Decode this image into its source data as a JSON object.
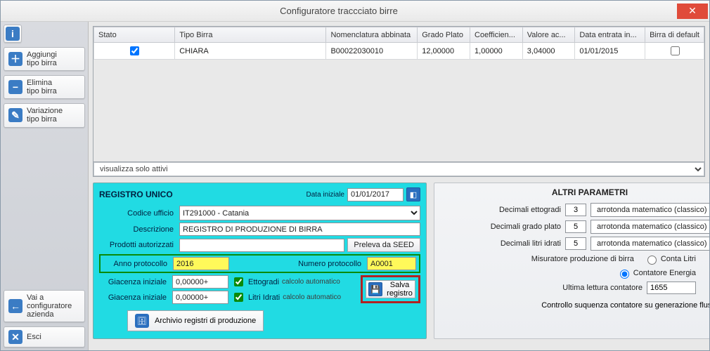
{
  "window": {
    "title": "Configuratore traccciato birre"
  },
  "sidebar": {
    "add": "Aggiungi\ntipo birra",
    "del": "Elimina\ntipo birra",
    "var": "Variazione\ntipo birra",
    "goto": "Vai a\nconfiguratore\nazienda",
    "exit": "Esci"
  },
  "grid": {
    "headers": {
      "stato": "Stato",
      "tipo": "Tipo Birra",
      "nomen": "Nomenclatura abbinata",
      "plato": "Grado Plato",
      "coef": "Coefficien...",
      "val": "Valore ac...",
      "data": "Data entrata in...",
      "def": "Birra di default"
    },
    "row": {
      "stato_checked": true,
      "tipo": "CHIARA",
      "nomen": "B00022030010",
      "plato": "12,00000",
      "coef": "1,00000",
      "val": "3,04000",
      "data": "01/01/2015",
      "def_checked": false
    },
    "filter": "visualizza solo attivi"
  },
  "registro": {
    "title": "REGISTRO UNICO",
    "data_iniziale_lbl": "Data iniziale",
    "data_iniziale": "01/01/2017",
    "codice_ufficio_lbl": "Codice ufficio",
    "codice_ufficio": "IT291000 - Catania",
    "descrizione_lbl": "Descrizione",
    "descrizione": "REGISTRO DI PRODUZIONE DI BIRRA",
    "prodotti_lbl": "Prodotti autorizzati",
    "prodotti": "",
    "seed_btn": "Preleva da SEED",
    "anno_lbl": "Anno protocollo",
    "anno": "2016",
    "num_lbl": "Numero protocollo",
    "num": "A0001",
    "giac1_lbl": "Giacenza iniziale",
    "giac1": "0,00000+",
    "giac2_lbl": "Giacenza iniziale",
    "giac2": "0,00000+",
    "ettogradi_lbl": "Ettogradi",
    "ettogradi_auto": "calcolo automatico",
    "litri_lbl": "Litri Idrati",
    "litri_auto": "calcolo automatico",
    "salva": "Salva\nregistro",
    "archivio": "Archivio registri di produzione"
  },
  "altri": {
    "title": "ALTRI PARAMETRI",
    "dec_etto_lbl": "Decimali ettogradi",
    "dec_etto": "3",
    "dec_plato_lbl": "Decimali grado plato",
    "dec_plato": "5",
    "dec_litri_lbl": "Decimali litri idrati",
    "dec_litri": "5",
    "round": "arrotonda matematico (classico)",
    "mis_lbl": "Misuratore produzione di birra",
    "r1": "Conta Litri",
    "r2": "Contatore Energia",
    "ult_lbl": "Ultima lettura contatore",
    "ult": "1655",
    "ctrl_lbl": "Controllo suquenza contatore su generazione flusso"
  }
}
